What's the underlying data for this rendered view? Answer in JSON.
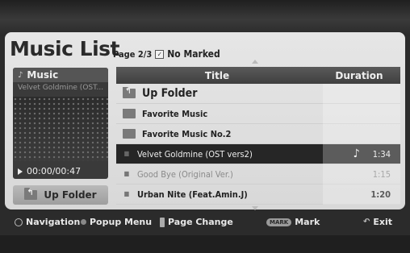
{
  "header": {
    "title": "Music List",
    "page_info": "Page 2/3",
    "marked_label": "No Marked"
  },
  "preview": {
    "category": "Music",
    "now_playing": "Velvet Goldmine (OST...",
    "time": "00:00/00:47",
    "up_folder_button": "Up Folder"
  },
  "table": {
    "columns": [
      "Title",
      "Duration"
    ],
    "rows": [
      {
        "type": "up-folder",
        "title": "Up Folder",
        "duration": ""
      },
      {
        "type": "folder",
        "title": "Favorite Music",
        "duration": ""
      },
      {
        "type": "folder",
        "title": "Favorite Music No.2",
        "duration": ""
      },
      {
        "type": "file",
        "title": "Velvet Goldmine (OST vers2)",
        "duration": "1:34",
        "selected": true
      },
      {
        "type": "file",
        "title": "Good Bye (Original Ver.)",
        "duration": "1:15"
      },
      {
        "type": "file",
        "title": "Urban Nite (Feat.Amin.J)",
        "duration": "1:20"
      }
    ]
  },
  "helpbar": {
    "navigation": "Navigation",
    "popup_menu": "Popup Menu",
    "page_change": "Page Change",
    "mark_key": "MARK",
    "mark": "Mark",
    "exit": "Exit"
  }
}
